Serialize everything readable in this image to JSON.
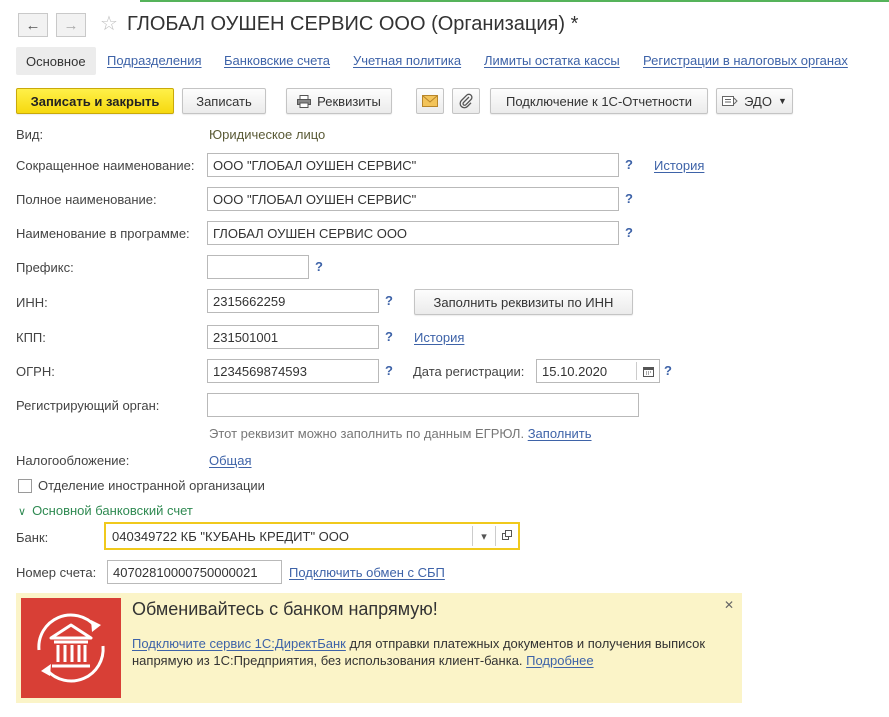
{
  "window": {
    "title": "ГЛОБАЛ ОУШЕН СЕРВИС ООО (Организация) *"
  },
  "tabs": [
    {
      "label": "Основное"
    },
    {
      "label": "Подразделения"
    },
    {
      "label": "Банковские счета"
    },
    {
      "label": "Учетная политика"
    },
    {
      "label": "Лимиты остатка кассы"
    },
    {
      "label": "Регистрации в налоговых органах"
    }
  ],
  "toolbar": {
    "save_close": "Записать и закрыть",
    "save": "Записать",
    "requisites": "Реквизиты",
    "connect_reporting": "Подключение к 1С-Отчетности",
    "edo": "ЭДО"
  },
  "form": {
    "kind_label": "Вид:",
    "kind_value": "Юридическое лицо",
    "short_name_label": "Сокращенное наименование:",
    "short_name_value": "ООО \"ГЛОБАЛ ОУШЕН СЕРВИС\"",
    "history_link": "История",
    "full_name_label": "Полное наименование:",
    "full_name_value": "ООО \"ГЛОБАЛ ОУШЕН СЕРВИС\"",
    "program_name_label": "Наименование в программе:",
    "program_name_value": "ГЛОБАЛ ОУШЕН СЕРВИС ООО",
    "prefix_label": "Префикс:",
    "prefix_value": "",
    "inn_label": "ИНН:",
    "inn_value": "2315662259",
    "fill_by_inn": "Заполнить реквизиты по ИНН",
    "kpp_label": "КПП:",
    "kpp_value": "231501001",
    "kpp_history_link": "История",
    "ogrn_label": "ОГРН:",
    "ogrn_value": "1234569874593",
    "reg_date_label": "Дата регистрации:",
    "reg_date_value": "15.10.2020",
    "reg_authority_label": "Регистрирующий орган:",
    "reg_authority_value": "",
    "egrul_hint": "Этот реквизит можно заполнить по данным ЕГРЮЛ.",
    "fill_link": "Заполнить",
    "taxation_label": "Налогообложение:",
    "taxation_value": "Общая",
    "foreign_branch_label": "Отделение иностранной организации",
    "help_mark": "?"
  },
  "bank_group": {
    "header": "Основной банковский счет",
    "bank_label": "Банк:",
    "bank_value": "040349722 КБ \"КУБАНЬ КРЕДИТ\" ООО",
    "account_label": "Номер счета:",
    "account_value": "40702810000750000021",
    "sbp_link": "Подключить обмен с СБП"
  },
  "banner": {
    "title": "Обменивайтесь с банком напрямую!",
    "link_text": "Подключите сервис 1С:ДиректБанк",
    "text": " для отправки платежных документов и получения выписок напрямую из 1С:Предприятия, без использования клиент-банка. ",
    "more_link": "Подробнее"
  },
  "colors": {
    "accent_yellow": "#f6d90f",
    "link_blue": "#3e63a8",
    "group_green": "#2f8a52",
    "banner_bg": "#fbf4c8",
    "banner_icon_red": "#d83f36"
  }
}
